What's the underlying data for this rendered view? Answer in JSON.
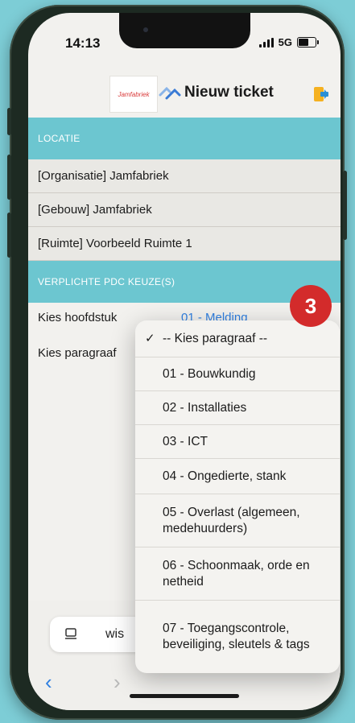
{
  "status": {
    "time": "14:13",
    "network": "5G"
  },
  "header": {
    "logo_text": "Jamfabriek",
    "title": "Nieuw ticket"
  },
  "sections": {
    "locatie": "LOCATIE",
    "verplicht": "VERPLICHTE PDC KEUZE(S)"
  },
  "location_rows": [
    "[Organisatie] Jamfabriek",
    "[Gebouw] Jamfabriek",
    "[Ruimte] Voorbeeld Ruimte 1"
  ],
  "fields": {
    "hoofdstuk_label": "Kies hoofdstuk",
    "hoofdstuk_value": "01 - Melding",
    "paragraaf_label": "Kies paragraaf"
  },
  "badge": "3",
  "dropdown": {
    "selected_index": 0,
    "options": [
      "-- Kies paragraaf --",
      "01 - Bouwkundig",
      "02 - Installaties",
      "03 - ICT",
      "04 - Ongedierte, stank",
      "05 - Overlast (algemeen, medehuurders)",
      "06 - Schoonmaak, orde en netheid",
      "07 - Toegangscontrole, beveiliging, sleutels & tags"
    ]
  },
  "browser": {
    "address_text": "wis"
  },
  "colors": {
    "accent": "#6cc6d0",
    "link": "#2f7fe0",
    "badge": "#d32b2b"
  }
}
